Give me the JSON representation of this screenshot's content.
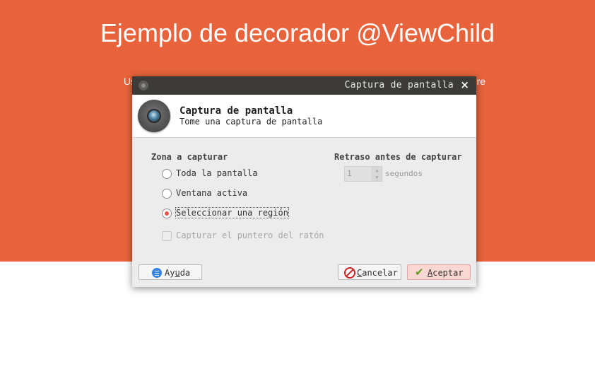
{
  "page": {
    "title": "Ejemplo de decorador @ViewChild",
    "subtitle": "Uso de propiedades y métodos de los componentes hijos en el componente Padre"
  },
  "dialog": {
    "window_title": "Captura de pantalla",
    "close_glyph": "×",
    "header": {
      "title": "Captura de pantalla",
      "subtitle": "Tome una captura de pantalla"
    },
    "capture_area": {
      "label": "Zona a capturar",
      "options": [
        {
          "label": "Toda la pantalla",
          "selected": false
        },
        {
          "label": "Ventana activa",
          "selected": false
        },
        {
          "label": "Seleccionar una región",
          "selected": true
        }
      ],
      "pointer_checkbox": {
        "label": "Capturar el puntero del ratón",
        "checked": false,
        "enabled": false
      }
    },
    "delay": {
      "label": "Retraso antes de capturar",
      "value": "1",
      "unit": "segundos",
      "enabled": false
    },
    "buttons": {
      "help": {
        "prefix": "Ay",
        "mnemonic": "u",
        "suffix": "da"
      },
      "cancel": {
        "prefix": "",
        "mnemonic": "C",
        "suffix": "ancelar"
      },
      "ok": {
        "prefix": "",
        "mnemonic": "A",
        "suffix": "ceptar"
      }
    }
  },
  "colors": {
    "hero_background": "#e8633b",
    "titlebar": "#3c3b37",
    "radio_selected": "#e5544a",
    "ok_button": "#fbd7d3"
  },
  "icons": {
    "window": "window-app-icon",
    "header": "camera-icon",
    "help": "help-icon",
    "cancel": "cancel-icon",
    "ok": "checkmark-icon"
  }
}
